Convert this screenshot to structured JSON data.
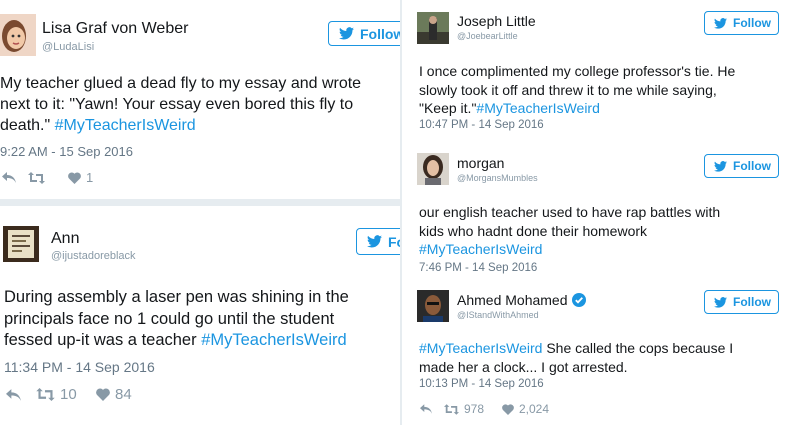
{
  "follow_label": "Follow",
  "tweets": [
    {
      "name": "Lisa Graf von Weber",
      "handle": "@LudaLisi",
      "lines": [
        "My teacher glued a dead fly to my essay and wrote",
        "next to it: \"Yawn! Your essay even bored this fly to",
        "death.\" "
      ],
      "hashtag": "#MyTeacherIsWeird",
      "time": "9:22 AM - 15 Sep 2016",
      "likes": "1"
    },
    {
      "name": "Ann",
      "handle": "@ijustadoreblack",
      "lines": [
        "During assembly a laser pen was shining in the",
        "principals face no 1 could go until the student",
        "fessed up-it was a teacher "
      ],
      "hashtag": "#MyTeacherIsWeird",
      "time": "11:34 PM - 14 Sep 2016",
      "retweets": "10",
      "likes": "84"
    },
    {
      "name": "Joseph Little",
      "handle": "@JoebearLittle",
      "lines": [
        "I once complimented my college professor's tie. He",
        "slowly took it off and threw it to me while saying,",
        "\"Keep it.\""
      ],
      "hashtag": "#MyTeacherIsWeird",
      "time": "10:47 PM - 14 Sep 2016"
    },
    {
      "name": "morgan",
      "handle": "@MorgansMumbles",
      "lines": [
        "our english teacher used to have rap battles with",
        "kids who hadnt done their homework"
      ],
      "hashtag": "#MyTeacherIsWeird",
      "time": "7:46 PM - 14 Sep 2016"
    },
    {
      "name": "Ahmed Mohamed",
      "handle": "@IStandWithAhmed",
      "hashtag": "#MyTeacherIsWeird",
      "lines": [
        " She called the cops because I",
        "made her a clock... I got arrested."
      ],
      "time": "10:13 PM - 14 Sep 2016",
      "retweets": "978",
      "likes": "2,024"
    }
  ],
  "colors": {
    "accent": "#1b95e0",
    "background": "#e6ecf0",
    "muted": "#8899a6"
  }
}
